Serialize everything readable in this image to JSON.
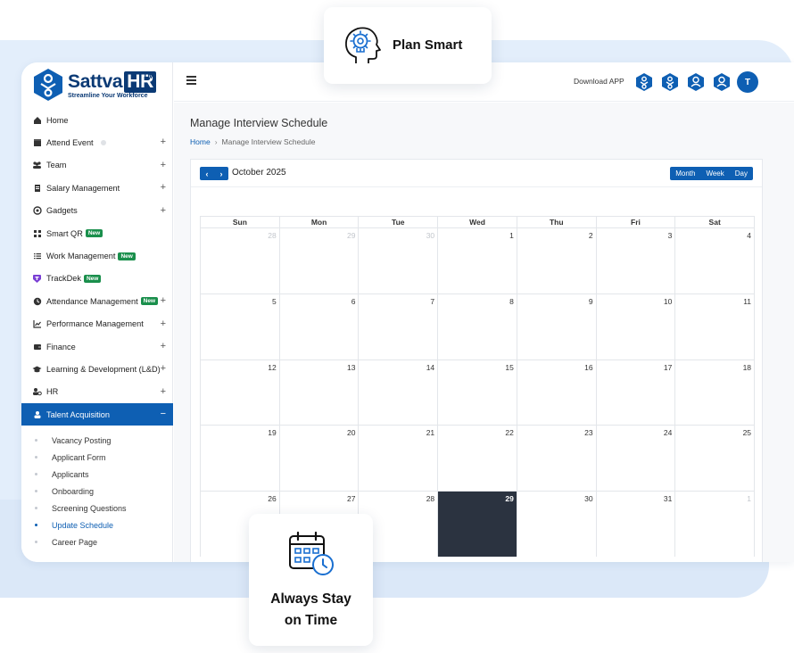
{
  "brand": {
    "name": "Sattva",
    "name_hr": "HR",
    "tm": "TM",
    "tagline": "Streamline Your Workforce"
  },
  "sidebar": {
    "items": [
      {
        "label": "Home",
        "icon": "home-icon"
      },
      {
        "label": "Attend Event",
        "icon": "calendar-icon"
      },
      {
        "label": "Team",
        "icon": "team-icon"
      },
      {
        "label": "Salary Management",
        "icon": "salary-icon"
      },
      {
        "label": "Gadgets",
        "icon": "gadget-icon"
      },
      {
        "label": "Smart QR",
        "icon": "qr-icon",
        "badge": "New"
      },
      {
        "label": "Work Management",
        "icon": "list-icon",
        "badge": "New"
      },
      {
        "label": "TrackDek",
        "icon": "trackdek-icon",
        "badge": "New"
      },
      {
        "label": "Attendance Management",
        "icon": "clock-icon",
        "badge": "New"
      },
      {
        "label": "Performance Management",
        "icon": "chart-icon"
      },
      {
        "label": "Finance",
        "icon": "wallet-icon"
      },
      {
        "label": "Learning & Development (L&D)",
        "icon": "graduation-icon"
      },
      {
        "label": "HR",
        "icon": "hr-icon"
      },
      {
        "label": "Talent Acquisition",
        "icon": "user-icon"
      }
    ],
    "expand_plus": "+",
    "collapse_minus": "−",
    "sub_items": [
      "Vacancy Posting",
      "Applicant Form",
      "Applicants",
      "Onboarding",
      "Screening Questions",
      "Update Schedule",
      "Career Page"
    ]
  },
  "topbar": {
    "download_label": "Download APP",
    "avatar_letter": "T"
  },
  "page": {
    "title": "Manage Interview Schedule",
    "breadcrumb_home": "Home",
    "breadcrumb_sep": "›",
    "breadcrumb_current": "Manage Interview Schedule"
  },
  "calendar": {
    "prev": "‹",
    "next": "›",
    "month_label": "October 2025",
    "views": [
      "Month",
      "Week",
      "Day"
    ],
    "weekdays": [
      "Sun",
      "Mon",
      "Tue",
      "Wed",
      "Thu",
      "Fri",
      "Sat"
    ],
    "weeks": [
      [
        "28",
        "29",
        "30",
        "1",
        "2",
        "3",
        "4"
      ],
      [
        "5",
        "6",
        "7",
        "8",
        "9",
        "10",
        "11"
      ],
      [
        "12",
        "13",
        "14",
        "15",
        "16",
        "17",
        "18"
      ],
      [
        "19",
        "20",
        "21",
        "22",
        "23",
        "24",
        "25"
      ],
      [
        "26",
        "27",
        "28",
        "29",
        "30",
        "31",
        "1"
      ]
    ],
    "today": "29",
    "accent_color": "#0e5fb3",
    "today_color": "#2b3340"
  },
  "cards": {
    "plan_label": "Plan Smart",
    "time_line1": "Always Stay",
    "time_line2": "on Time"
  }
}
